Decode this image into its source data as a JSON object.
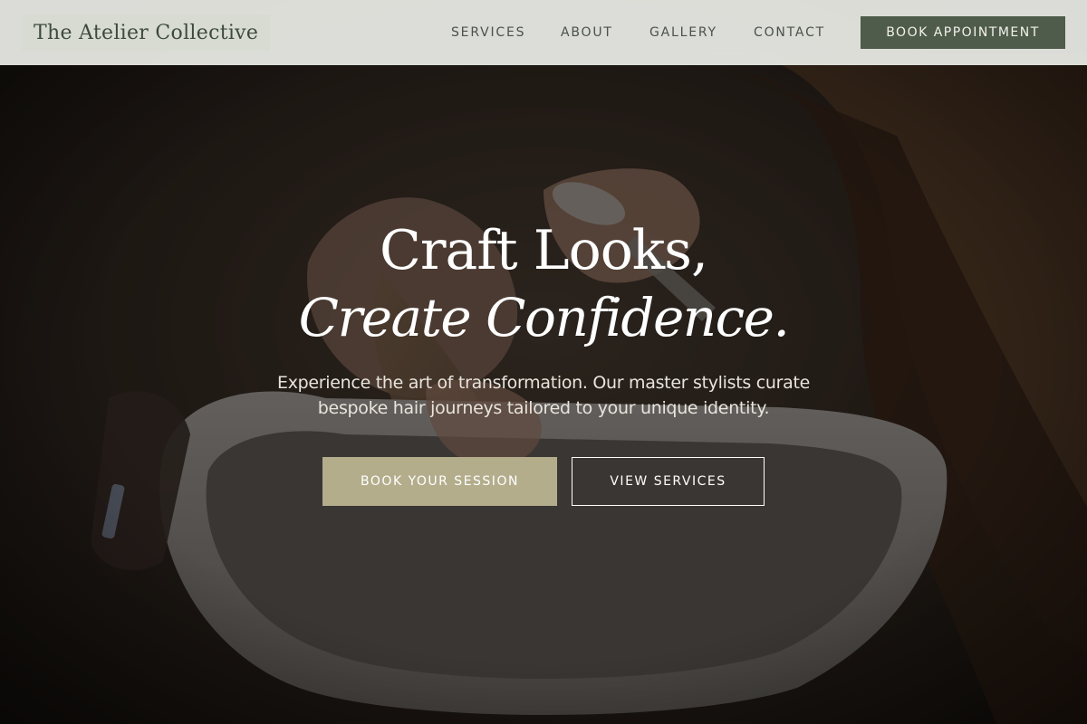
{
  "header": {
    "logo_text": "The Atelier Collective",
    "nav": [
      {
        "label": "SERVICES"
      },
      {
        "label": "ABOUT"
      },
      {
        "label": "GALLERY"
      },
      {
        "label": "CONTACT"
      }
    ],
    "cta_label": "BOOK APPOINTMENT"
  },
  "hero": {
    "headline_line1": "Craft Looks,",
    "headline_line2": "Create Confidence.",
    "tagline_line1": "Experience the art of transformation. Our master stylists curate",
    "tagline_line2": "bespoke hair journeys tailored to your unique identity.",
    "primary_button": "BOOK YOUR SESSION",
    "secondary_button": "VIEW SERVICES"
  },
  "colors": {
    "header_bg": "#e9eae4",
    "accent_dark_green": "#4f5b4b",
    "accent_khaki": "#b3ad8c",
    "overlay": "#1c1814"
  }
}
